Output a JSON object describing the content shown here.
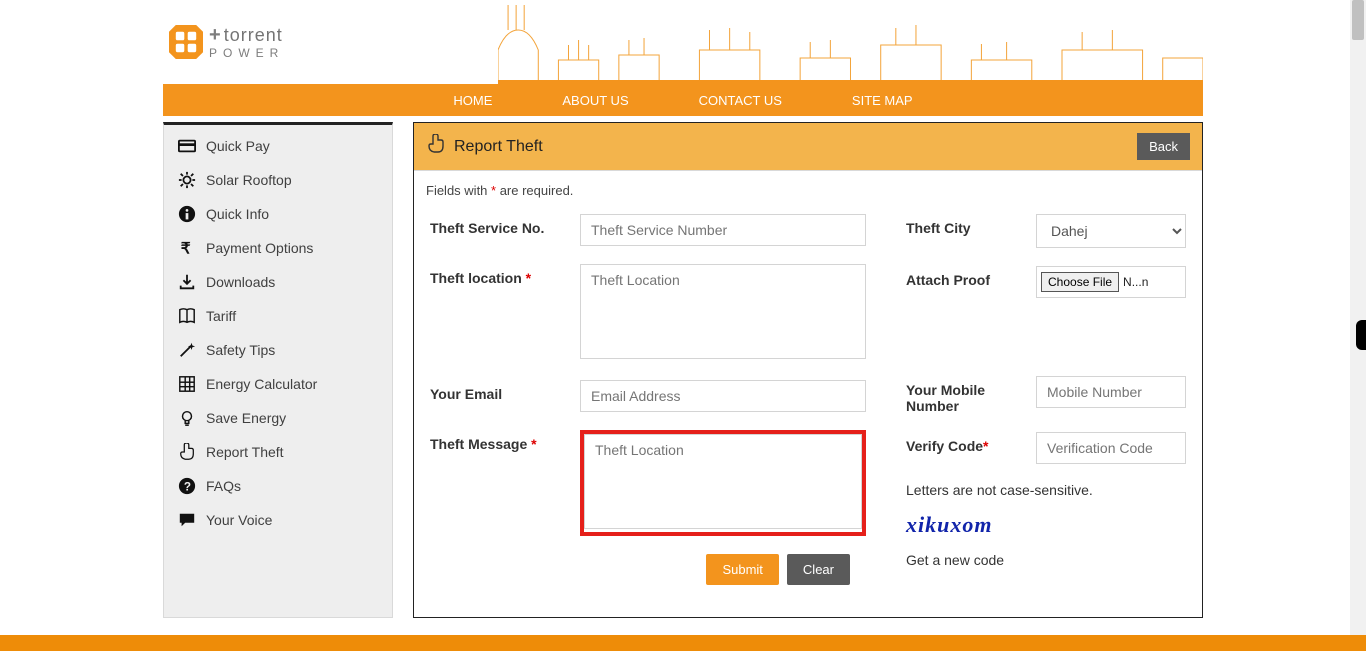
{
  "brand": {
    "name": "torrent",
    "sub": "POWER"
  },
  "nav": {
    "home": "HOME",
    "about": "ABOUT US",
    "contact": "CONTACT US",
    "sitemap": "SITE MAP"
  },
  "sidebar": {
    "items": [
      {
        "label": "Quick Pay",
        "icon": "card"
      },
      {
        "label": "Solar Rooftop",
        "icon": "gear"
      },
      {
        "label": "Quick Info",
        "icon": "info"
      },
      {
        "label": "Payment Options",
        "icon": "rupee"
      },
      {
        "label": "Downloads",
        "icon": "download"
      },
      {
        "label": "Tariff",
        "icon": "book"
      },
      {
        "label": "Safety Tips",
        "icon": "wand"
      },
      {
        "label": "Energy Calculator",
        "icon": "grid"
      },
      {
        "label": "Save Energy",
        "icon": "bulb"
      },
      {
        "label": "Report Theft",
        "icon": "point"
      },
      {
        "label": "FAQs",
        "icon": "help"
      },
      {
        "label": "Your Voice",
        "icon": "chat"
      }
    ]
  },
  "panel": {
    "title": "Report Theft",
    "back": "Back",
    "required_note_prefix": "Fields with ",
    "required_note_suffix": " are required."
  },
  "form": {
    "service_no_label": "Theft Service No.",
    "service_no_ph": "Theft Service Number",
    "location_label": "Theft location",
    "location_ph": "Theft Location",
    "email_label": "Your Email",
    "email_ph": "Email Address",
    "message_label": "Theft Message",
    "message_ph": "Theft Location",
    "city_label": "Theft City",
    "city_value": "Dahej",
    "proof_label": "Attach Proof",
    "choose_file": "Choose File",
    "no_file": "N...n",
    "mobile_label": "Your Mobile Number",
    "mobile_ph": "Mobile Number",
    "verify_label": "Verify Code",
    "verify_ph": "Verification Code",
    "captcha_note": "Letters are not case-sensitive.",
    "captcha_text": "xikuxom",
    "new_code": "Get a new code",
    "submit": "Submit",
    "clear": "Clear"
  }
}
